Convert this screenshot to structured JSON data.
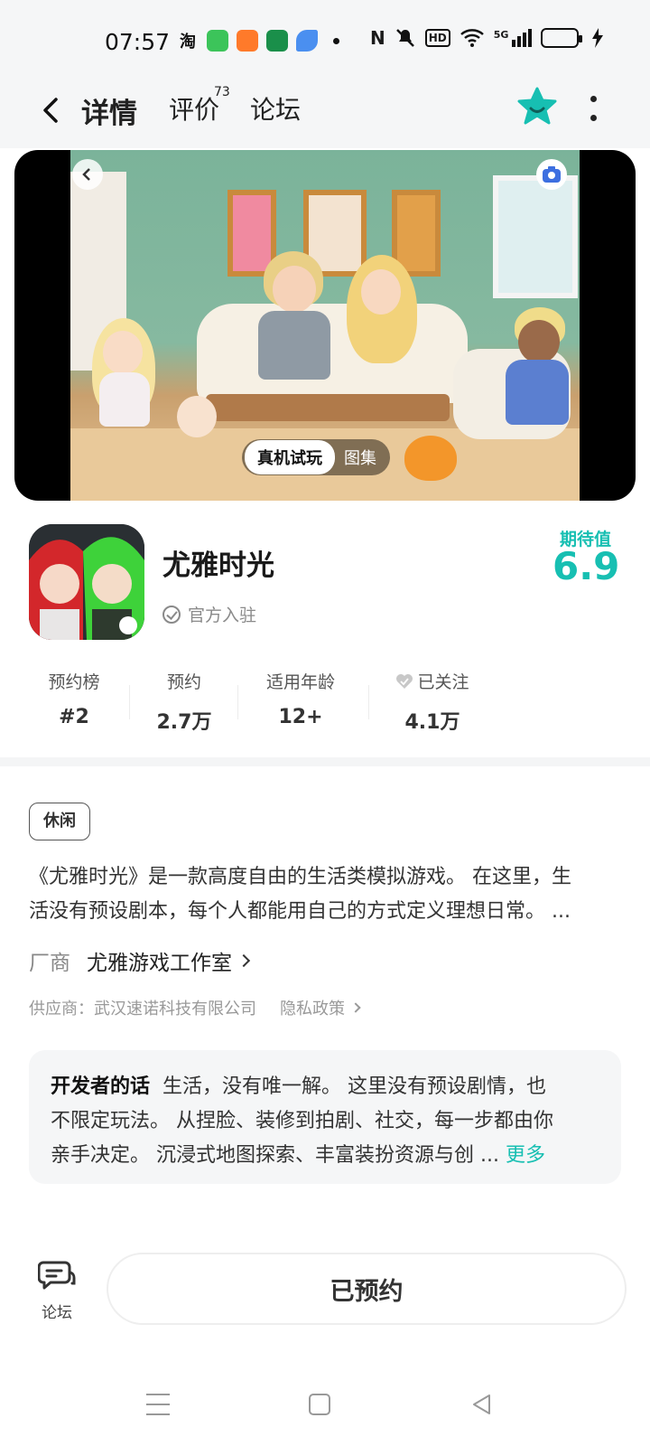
{
  "status_bar": {
    "time": "07:57",
    "apps": [
      {
        "icon": "taobao-icon",
        "text": "淘",
        "color": "#ff5000"
      },
      {
        "icon": "app-green-icon",
        "text": "",
        "color": "#3cc45a"
      },
      {
        "icon": "app-orange-icon",
        "text": "",
        "color": "#ff7a2a"
      },
      {
        "icon": "oppo-icon",
        "text": "",
        "color": "#1a8f4a"
      },
      {
        "icon": "app-blue-icon",
        "text": "",
        "color": "#4a8ff0"
      }
    ],
    "network": "5G",
    "hd": "HD"
  },
  "nav": {
    "tabs": [
      {
        "label": "详情",
        "active": true
      },
      {
        "label": "评价",
        "badge": "73"
      },
      {
        "label": "论坛"
      }
    ]
  },
  "hero": {
    "switch_active": "真机试玩",
    "switch_other": "图集"
  },
  "app": {
    "name": "尤雅时光",
    "official": "官方入驻",
    "rating_label": "期待值",
    "rating_value": "6.9",
    "accent_color": "#17bfb2"
  },
  "stats": [
    {
      "label": "预约榜",
      "value": "#2"
    },
    {
      "label": "预约",
      "value": "2.7万"
    },
    {
      "label": "适用年龄",
      "value": "12+"
    },
    {
      "label": "已关注",
      "value": "4.1万",
      "icon": "heart-icon"
    }
  ],
  "details": {
    "tag": "休闲",
    "description_line1": "《尤雅时光》是一款高度自由的生活类模拟游戏。 在这里，生",
    "description_line2": "活没有预设剧本，每个人都能用自己的方式定义理想日常。 ...",
    "maker_label": "厂商",
    "maker_name": "尤雅游戏工作室",
    "supplier": "供应商：武汉速诺科技有限公司",
    "privacy": "隐私政策"
  },
  "developer": {
    "title": "开发者的话",
    "line1": "生活，没有唯一解。 这里没有预设剧情，也",
    "line2": "不限定玩法。 从捏脸、装修到拍剧、社交，每一步都由你",
    "line3": "亲手决定。 沉浸式地图探索、丰富装扮资源与创 ...",
    "more": "更多"
  },
  "bottom": {
    "forum_label": "论坛",
    "reserve_label": "已预约"
  }
}
